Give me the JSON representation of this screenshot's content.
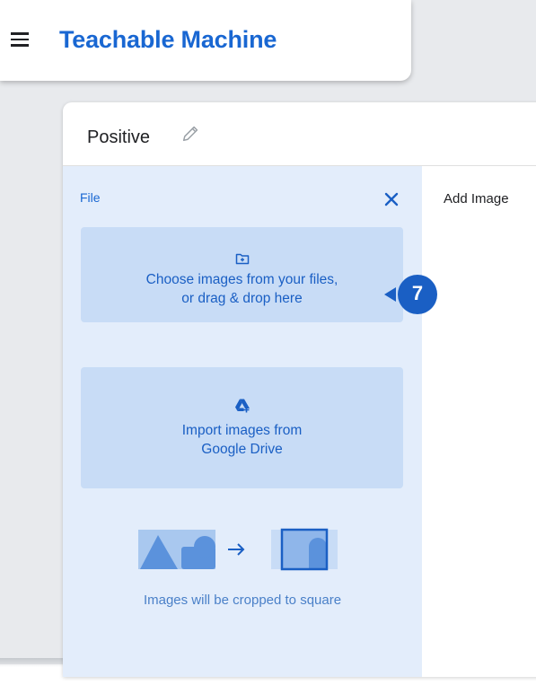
{
  "app": {
    "title": "Teachable Machine",
    "menu_icon": "hamburger-menu-icon"
  },
  "class_card": {
    "name": "Positive",
    "edit_icon": "pencil-icon",
    "upload_panel": {
      "label": "File",
      "close_icon": "close-icon",
      "files_tile": {
        "icon": "folder-upload-icon",
        "line1": "Choose images from your files,",
        "line2": "or drag & drop here"
      },
      "drive_tile": {
        "icon": "google-drive-icon",
        "line1": "Import images from",
        "line2": "Google Drive"
      },
      "crop_caption": "Images will be cropped to square"
    },
    "samples_label": "Add Image"
  },
  "annotation": {
    "step_number": "7"
  },
  "colors": {
    "brand_blue": "#1967d2",
    "panel_bg": "#e3edfb",
    "tile_bg": "#c8dcf6",
    "step_marker": "#1a5fc4"
  }
}
